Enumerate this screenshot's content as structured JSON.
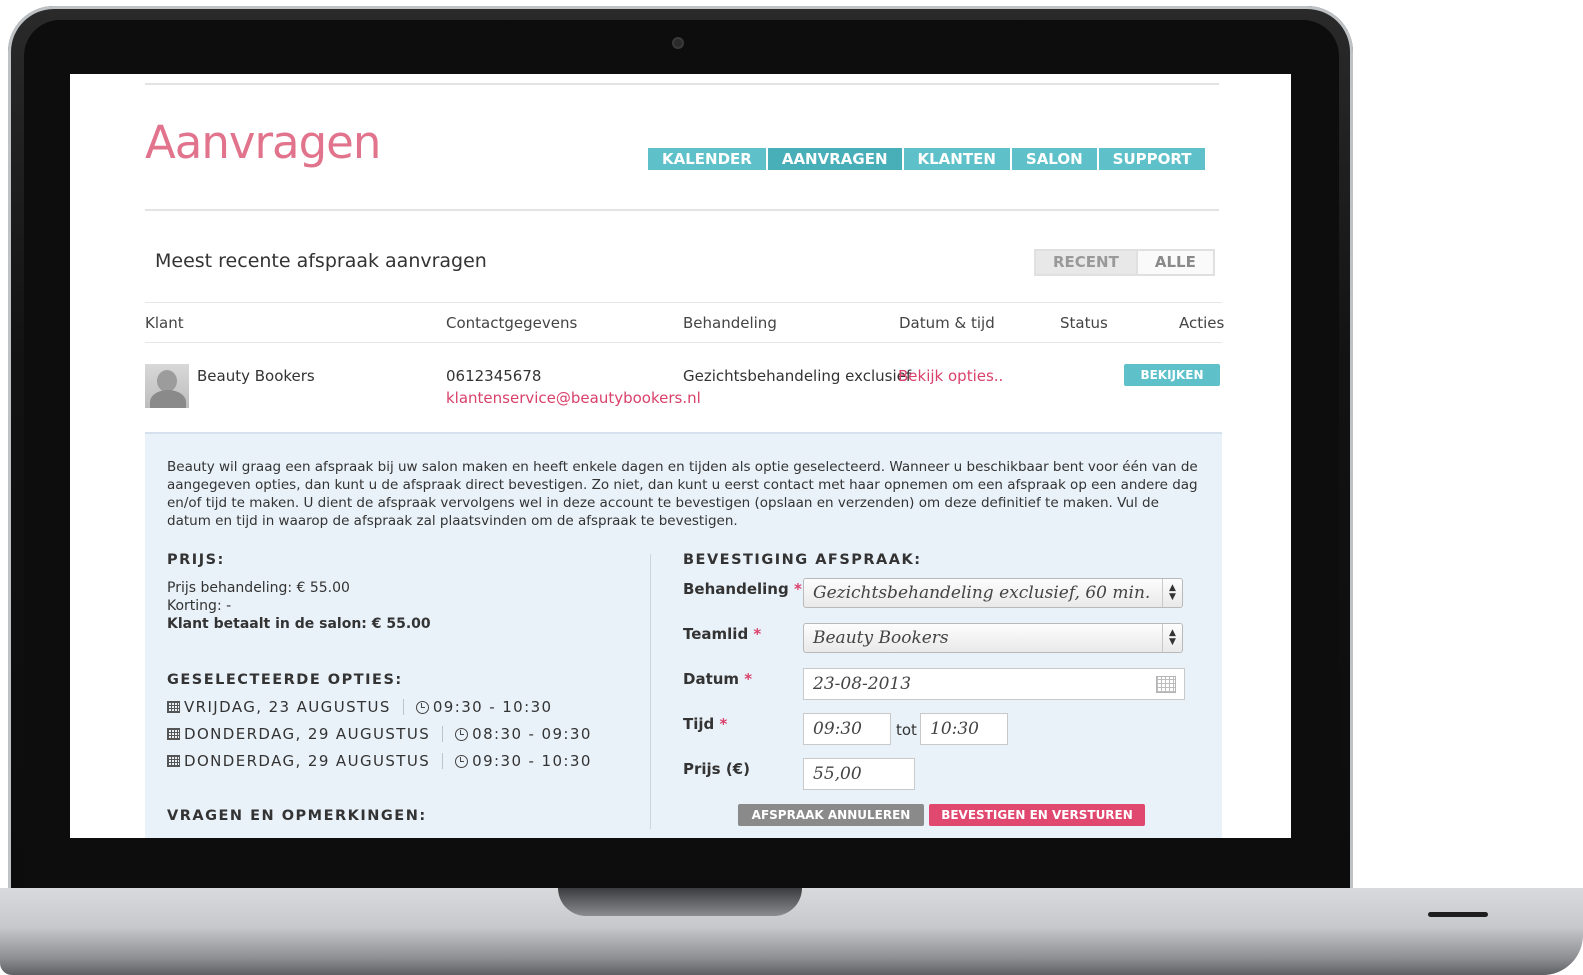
{
  "header": {
    "title": "Aanvragen",
    "nav": [
      "KALENDER",
      "AANVRAGEN",
      "KLANTEN",
      "SALON",
      "SUPPORT"
    ],
    "active_nav": "AANVRAGEN"
  },
  "list": {
    "heading": "Meest recente afspraak aanvragen",
    "filters": [
      "RECENT",
      "ALLE"
    ],
    "active_filter": "RECENT",
    "columns": [
      "Klant",
      "Contactgegevens",
      "Behandeling",
      "Datum & tijd",
      "Status",
      "Acties"
    ],
    "row": {
      "client": "Beauty Bookers",
      "phone": "0612345678",
      "email": "klantenservice@beautybookers.nl",
      "treatment": "Gezichtsbehandeling exclusief",
      "options_link": "Bekijk opties..",
      "status": "",
      "action": "BEKIJKEN"
    }
  },
  "detail": {
    "intro": "Beauty wil graag een afspraak bij uw salon maken en heeft enkele dagen en tijden als optie geselecteerd. Wanneer u beschikbaar bent voor één van de aangegeven opties, dan kunt u de afspraak direct bevestigen. Zo niet, dan kunt u eerst contact met haar opnemen om een afspraak op een andere dag en/of tijd te maken. U dient de afspraak vervolgens wel in deze account te bevestigen (opslaan en verzenden) om deze definitief te maken. Vul de datum en tijd in waarop de afspraak zal plaatsvinden om de afspraak te bevestigen.",
    "price_heading": "PRIJS:",
    "price_treatment": "Prijs behandeling: € 55.00",
    "discount": "Korting: -",
    "total": "Klant betaalt in de salon: € 55.00",
    "options_heading": "GESELECTEERDE OPTIES:",
    "options": [
      {
        "date": "VRIJDAG, 23 AUGUSTUS",
        "time": "09:30 - 10:30"
      },
      {
        "date": "DONDERDAG, 29 AUGUSTUS",
        "time": "08:30 - 09:30"
      },
      {
        "date": "DONDERDAG, 29 AUGUSTUS",
        "time": "09:30 - 10:30"
      }
    ],
    "questions_heading": "VRAGEN EN OPMERKINGEN:",
    "confirm_heading": "BEVESTIGING AFSPRAAK:",
    "form": {
      "treatment_label": "Behandeling",
      "treatment_value": "Gezichtsbehandeling exclusief, 60 min.",
      "team_label": "Teamlid",
      "team_value": "Beauty Bookers",
      "date_label": "Datum",
      "date_value": "23-08-2013",
      "time_label": "Tijd",
      "time_from": "09:30",
      "time_sep": "tot",
      "time_to": "10:30",
      "price_label": "Prijs (€)",
      "price_value": "55,00",
      "required_mark": "*"
    },
    "cancel_button": "AFSPRAAK ANNULEREN",
    "confirm_button": "BEVESTIGEN EN VERSTUREN"
  }
}
